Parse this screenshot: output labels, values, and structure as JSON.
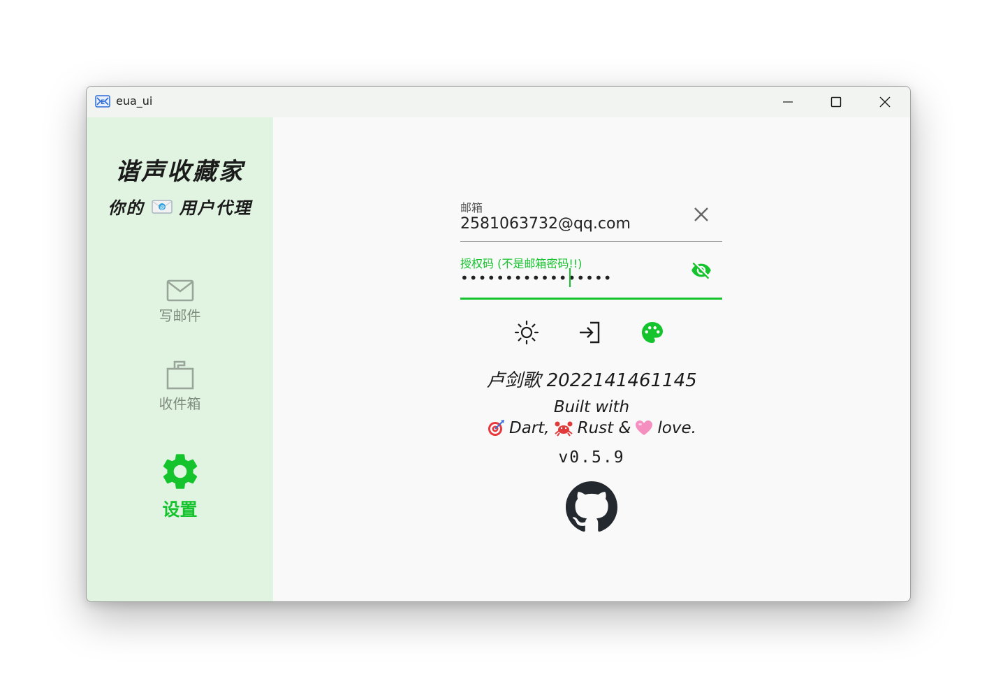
{
  "window": {
    "title": "eua_ui",
    "icon": "envelope-app-icon",
    "controls": [
      "minimize-icon",
      "maximize-icon",
      "close-icon"
    ]
  },
  "sidebar": {
    "brand_title": "谐声收藏家",
    "brand_sub_left": "你的",
    "brand_sub_right": "用户代理",
    "items": [
      {
        "label": "写邮件",
        "icon": "mail-icon",
        "active": false
      },
      {
        "label": "收件箱",
        "icon": "inbox-icon",
        "active": false
      },
      {
        "label": "设置",
        "icon": "gear-icon",
        "active": true
      }
    ]
  },
  "form": {
    "email_label": "邮箱",
    "email_value": "2581063732@qq.com",
    "password_label": "授权码 (不是邮箱密码!!)",
    "password_value": "•••••••••••••••••"
  },
  "actions": [
    "brightness-icon",
    "login-icon",
    "palette-icon"
  ],
  "about": {
    "author": "卢剑歌 2022141461145",
    "built_line1": "Built with",
    "dart": "Dart,",
    "rust": "Rust &",
    "love": "love.",
    "version": "v0.5.9"
  },
  "colors": {
    "accent": "#15c32c",
    "sidebar_bg": "#e0f4e1",
    "content_bg": "#f9f9f9",
    "inactive": "#7f8a7f"
  }
}
